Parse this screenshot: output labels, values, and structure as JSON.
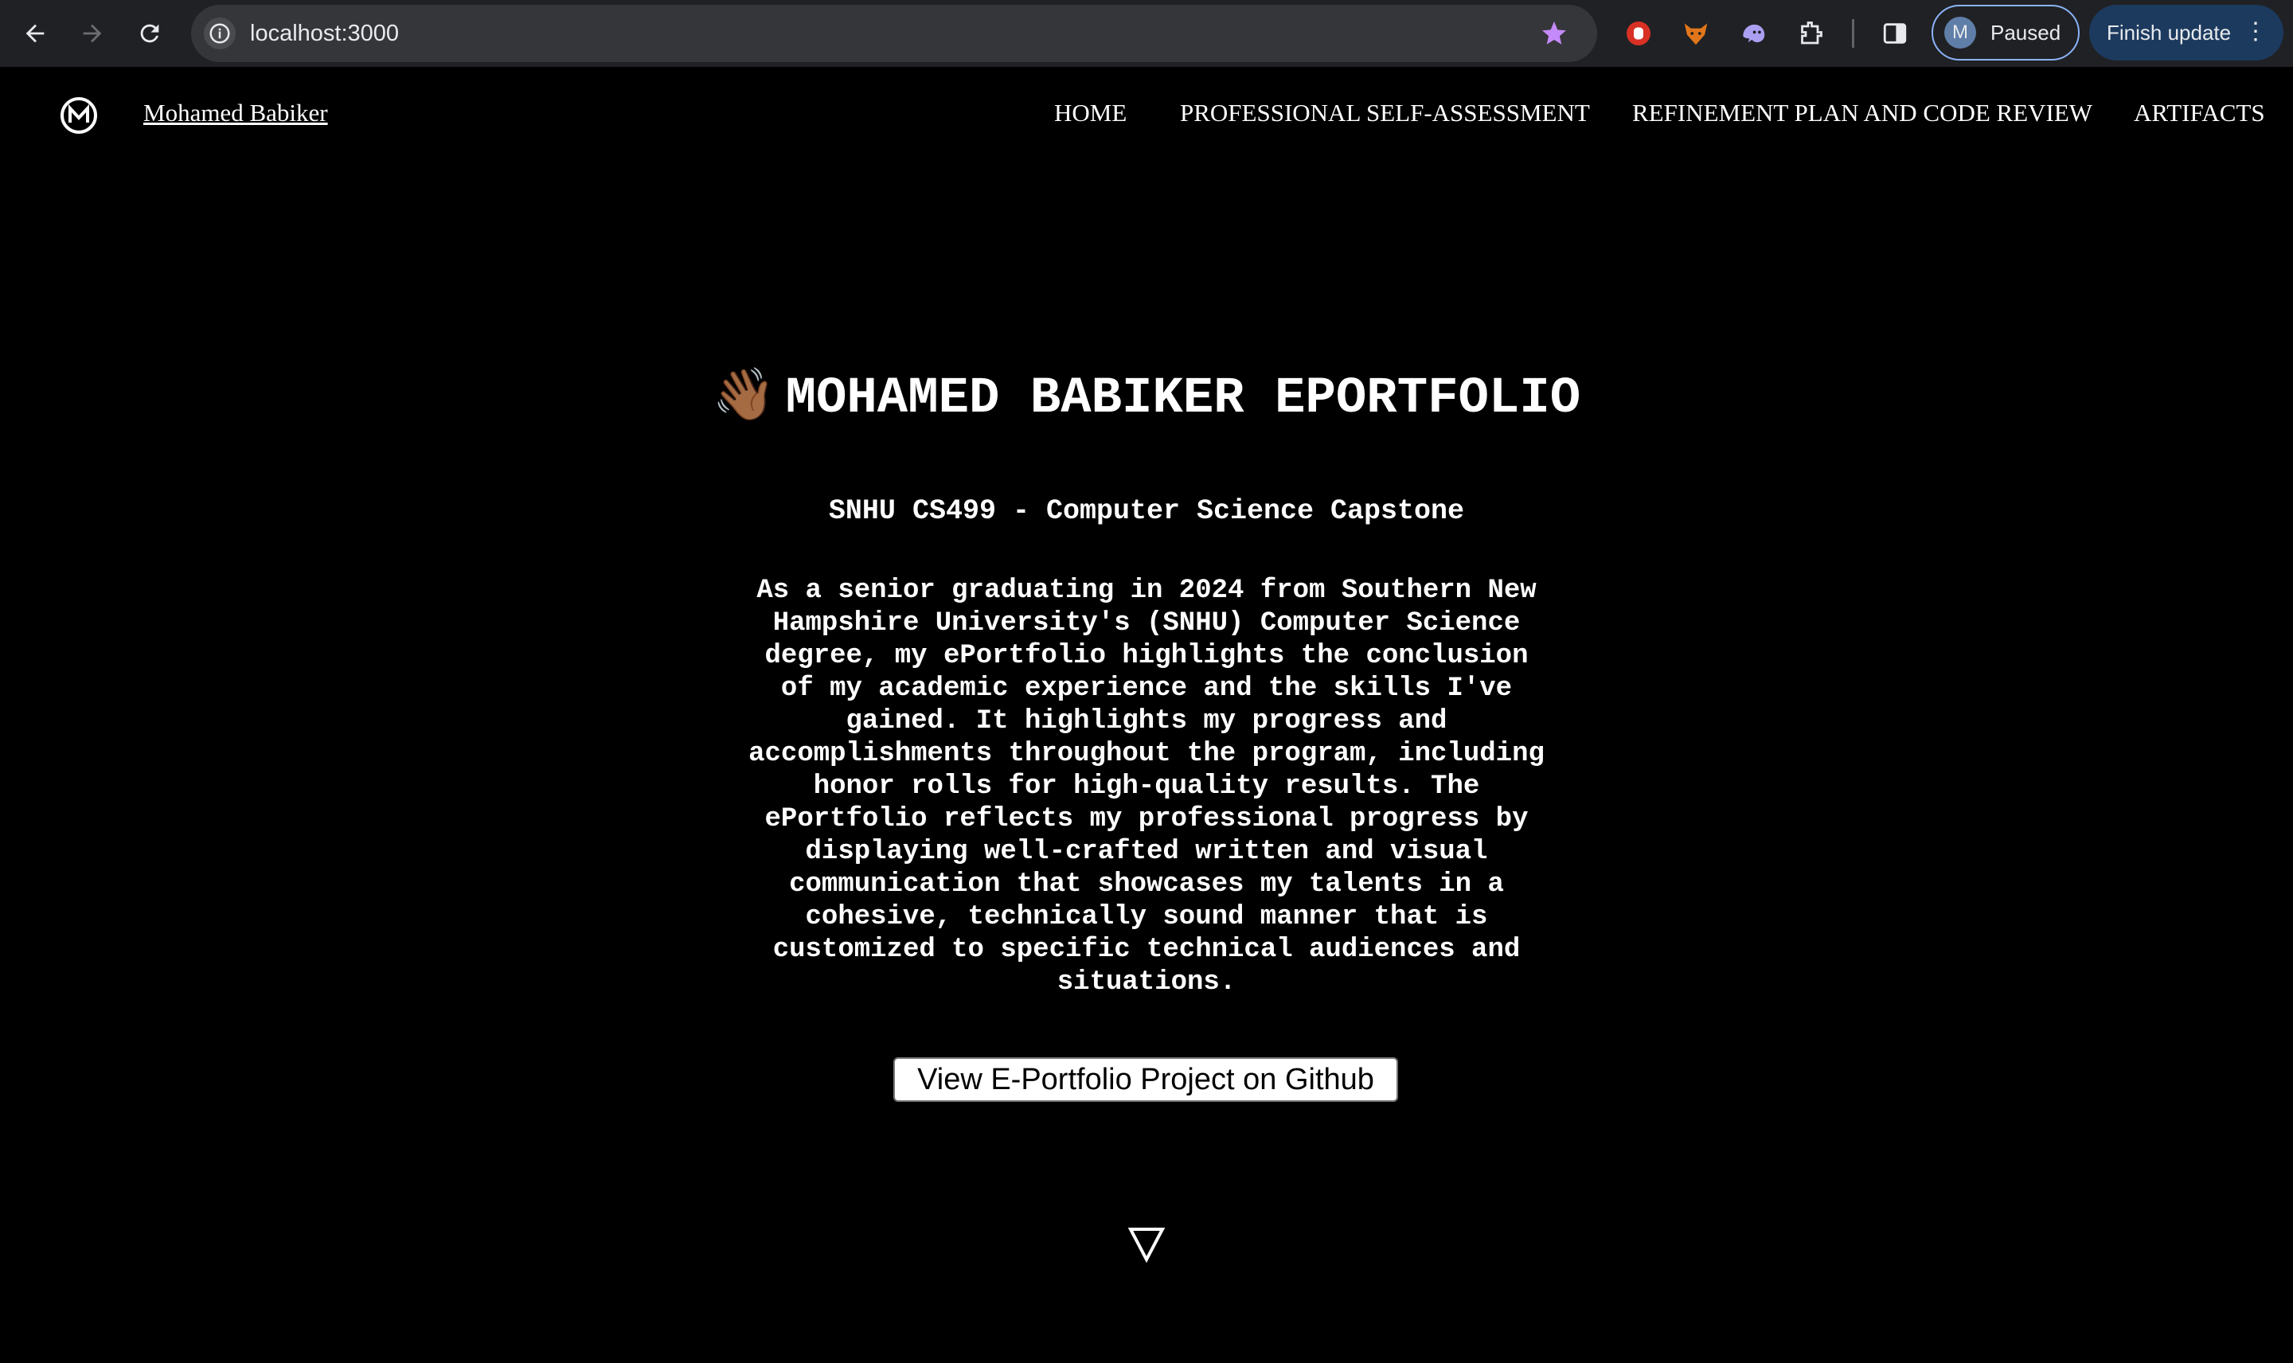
{
  "browser": {
    "url": "localhost:3000",
    "profile_initial": "M",
    "profile_status": "Paused",
    "update_label": "Finish update"
  },
  "site": {
    "brand": "Mohamed Babiker",
    "nav": [
      "HOME",
      "PROFESSIONAL SELF-ASSESSMENT",
      "REFINEMENT PLAN AND CODE REVIEW",
      "ARTIFACTS"
    ]
  },
  "hero": {
    "wave_emoji": "👋🏾",
    "title": "MOHAMED BABIKER EPORTFOLIO",
    "subtitle": "SNHU CS499 - Computer Science Capstone",
    "intro": "As a senior graduating in 2024 from Southern New Hampshire University's (SNHU) Computer Science degree, my ePortfolio highlights the conclusion of my academic experience and the skills I've gained. It highlights my progress and accomplishments throughout the program, including honor rolls for high-quality results. The ePortfolio reflects my professional progress by displaying well-crafted written and visual communication that showcases my talents in a cohesive, technically sound manner that is customized to specific technical audiences and situations.",
    "button_label": "View E-Portfolio Project on Github"
  },
  "icons": {
    "back": "back-arrow-icon",
    "forward": "forward-arrow-icon",
    "reload": "reload-icon",
    "info": "info-icon",
    "bookmark": "star-icon",
    "scroll": "down-triangle-icon"
  },
  "colors": {
    "page_bg": "#000000",
    "chrome_bg": "#202124",
    "omnibox_bg": "#35363a",
    "star": "#c58af9",
    "profile_border": "#8ab4f8",
    "update_bg": "#1c3a5e"
  }
}
